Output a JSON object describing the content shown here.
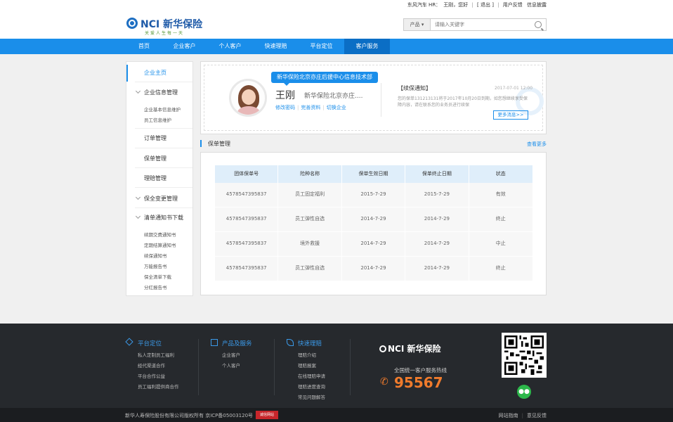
{
  "topbar": {
    "company": "东风汽车 HR：",
    "user": "王刚",
    "greeting": "，您好",
    "logout": "[ 退出 ]",
    "feedback": "用户反馈",
    "info_report": "信息披露"
  },
  "header": {
    "brand": "NCI 新华保险",
    "slogan": "关爱人生每一天",
    "search": {
      "category": "产品",
      "placeholder": "请输入关键字"
    }
  },
  "nav": {
    "items": [
      "首页",
      "企业客户",
      "个人客户",
      "快速理赔",
      "平台定位",
      "客户服务"
    ],
    "active_index": 5
  },
  "sidebar": {
    "home": "企业主页",
    "info_mgmt": "企业信息管理",
    "info_subs": [
      "企业基本信息维护",
      "员工信息维护"
    ],
    "order_mgmt": "订单管理",
    "policy_mgmt": "保单管理",
    "claim_mgmt": "理赔管理",
    "change_mgmt": "保全变更管理",
    "notice_dl": "清单通知书下载",
    "notice_subs": [
      "续期交费通知书",
      "定期结算通知书",
      "续保通知书",
      "万能报告书",
      "保全清单下载",
      "分红报告书"
    ]
  },
  "profile": {
    "department": "新华保险北京亦庄后援中心信息技术部",
    "name": "王刚",
    "company": "新华保险北京亦庄....",
    "links": [
      "修改密码",
      "完善资料",
      "切换企业"
    ]
  },
  "notice": {
    "title": "【续保通知】",
    "date": "2017-07-01 12:00",
    "text": "您的保单131213131将于2017年10月20日到期，如您想继续享受保障内容，请在联系您的业务员进行续保",
    "more": "更多消息>>"
  },
  "policy": {
    "section_title": "保单管理",
    "more": "查看更多",
    "columns": [
      "团体保单号",
      "险种名称",
      "保单生效日期",
      "保单终止日期",
      "状态"
    ],
    "rows": [
      [
        "4578547395837",
        "员工固定福利",
        "2015-7-29",
        "2015-7-29",
        "有效"
      ],
      [
        "4578547395837",
        "员工弹性自选",
        "2014-7-29",
        "2014-7-29",
        "终止"
      ],
      [
        "4578547395837",
        "境外救援",
        "2014-7-29",
        "2014-7-29",
        "中止"
      ],
      [
        "4578547395837",
        "员工弹性自选",
        "2014-7-29",
        "2014-7-29",
        "终止"
      ]
    ]
  },
  "footer": {
    "col1": {
      "title": "平台定位",
      "links": [
        "私人定制员工福利",
        "经代渠道合作",
        "平台合作公益",
        "员工福利提供商合作"
      ]
    },
    "col2": {
      "title": "产品及服务",
      "links": [
        "企业客户",
        "个人客户"
      ]
    },
    "col3": {
      "title": "快速理赔",
      "links": [
        "理赔介绍",
        "理赔报案",
        "在线理赔申请",
        "理赔进度查询",
        "常见问题解答"
      ]
    },
    "brand": "NCI 新华保险",
    "hotline_label": "全国统一客户服务热线",
    "hotline": "95567"
  },
  "copyright": {
    "text": "新华人寿保险股份有限公司版权所有  京ICP备05003120号",
    "badge": "诚信网站",
    "links": [
      "网站指南",
      "意见反馈"
    ]
  },
  "colors": {
    "primary": "#1a8eea",
    "nav_active": "#0b6ec5",
    "hotline": "#f07b2c",
    "footer_bg": "#26292d"
  }
}
